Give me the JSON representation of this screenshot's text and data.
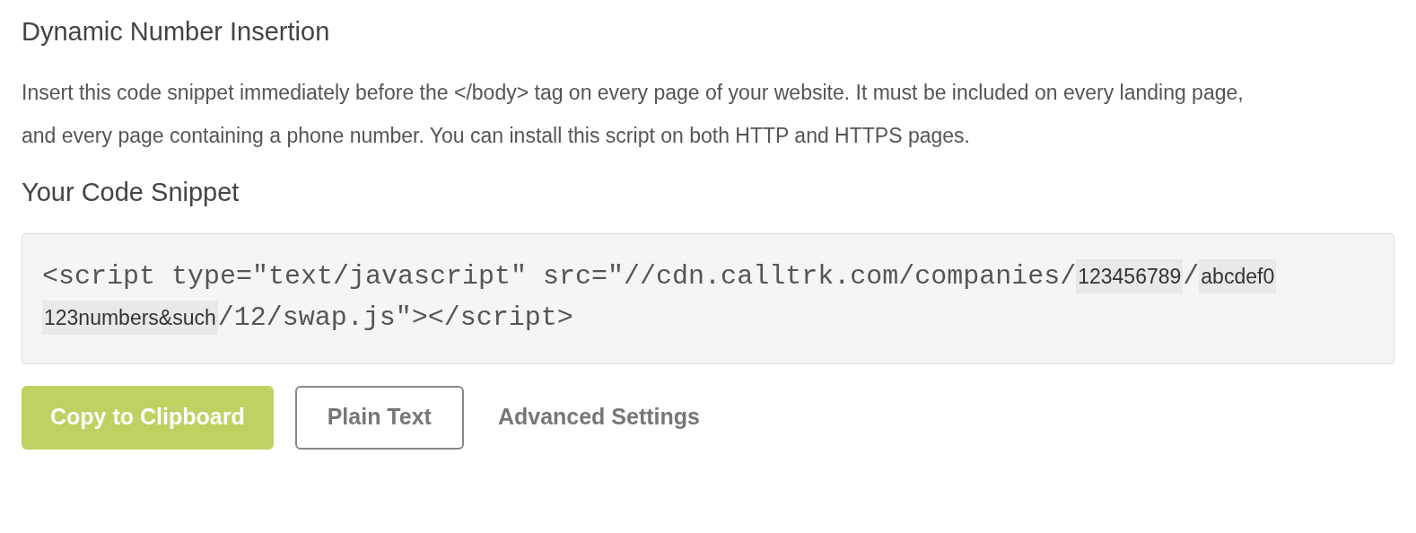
{
  "title": "Dynamic Number Insertion",
  "description": "Insert this code snippet immediately before the </body> tag on every page of your website. It must be included on every landing page, and every page containing a phone number. You can install this script on both HTTP and HTTPS pages.",
  "snippet_heading": "Your Code Snippet",
  "snippet": [
    {
      "kind": "code",
      "text": "<script type=\"text/javascript\" src=\"//cdn.calltrk.com/companies/"
    },
    {
      "kind": "token",
      "text": "123456789 "
    },
    {
      "kind": "code",
      "text": "/"
    },
    {
      "kind": "token",
      "text": "abcdef0"
    },
    {
      "kind": "token",
      "text": "123numbers&such"
    },
    {
      "kind": "code",
      "text": "/12/swap.js\"></script>"
    }
  ],
  "buttons": [
    {
      "kind": "primary",
      "label": "Copy to Clipboard"
    },
    {
      "kind": "outline",
      "label": "Plain Text"
    },
    {
      "kind": "link",
      "label": "Advanced Settings"
    }
  ]
}
